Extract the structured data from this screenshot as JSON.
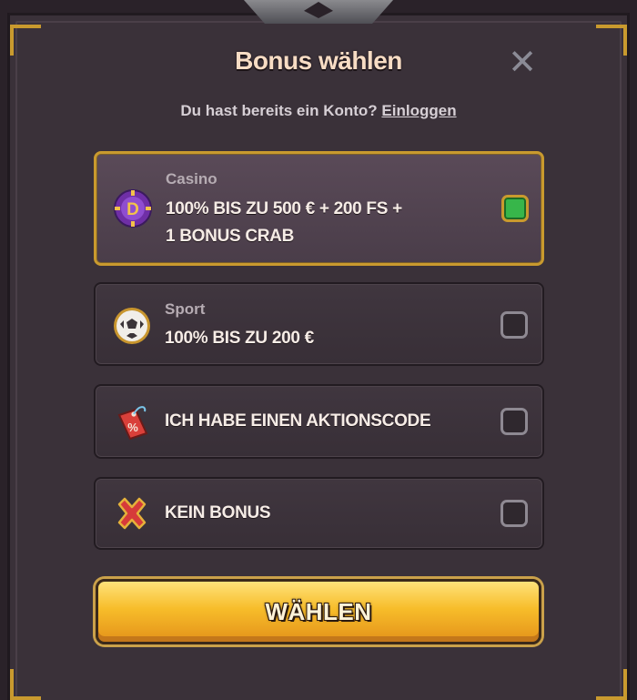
{
  "dialog": {
    "title": "Bonus wählen",
    "close_label": "✕",
    "subtitle_prefix": "Du hast bereits ein Konto?",
    "login_link": "Einloggen"
  },
  "options": [
    {
      "category": "Casino",
      "line1": "100% BIS ZU 500 € + 200 FS +",
      "line2": "1 BONUS CRAB",
      "icon": "casino-chip-icon",
      "selected": true
    },
    {
      "category": "Sport",
      "line1": "100% BIS ZU 200 €",
      "icon": "soccer-ball-icon",
      "selected": false
    },
    {
      "line1": "ICH HABE EINEN AKTIONSCODE",
      "icon": "promo-tag-icon",
      "selected": false
    },
    {
      "line1": "KEIN BONUS",
      "icon": "red-x-icon",
      "selected": false
    }
  ],
  "cta": {
    "label": "WÄHLEN"
  },
  "colors": {
    "gold": "#c99a2e",
    "checked": "#37b64a",
    "panel": "#3a3139"
  }
}
